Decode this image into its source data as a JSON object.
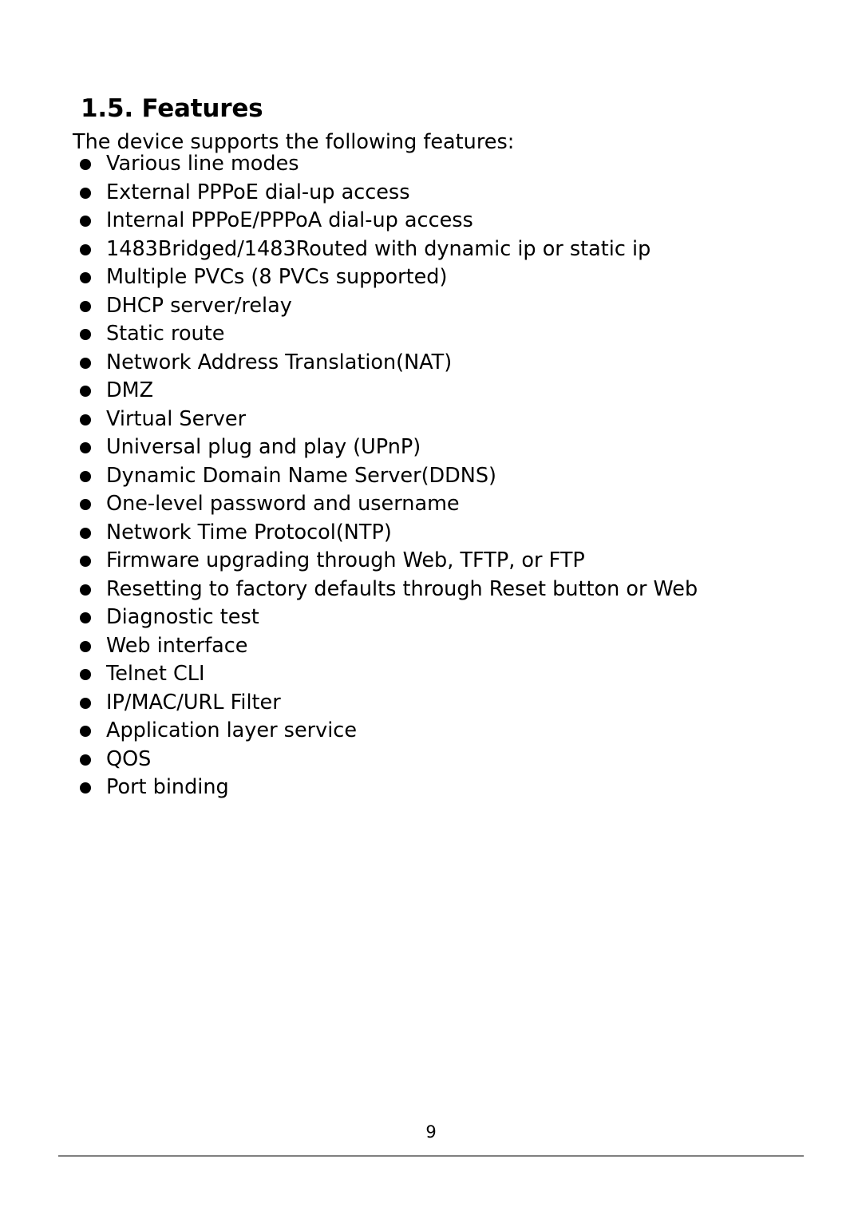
{
  "document": {
    "heading": "1.5. Features",
    "intro": "The device supports the following features:",
    "features": [
      "Various line modes",
      "External PPPoE dial-up access",
      "Internal PPPoE/PPPoA dial-up access",
      "1483Bridged/1483Routed with dynamic ip or static ip",
      "Multiple PVCs (8 PVCs supported)",
      "DHCP server/relay",
      "Static route",
      "Network Address Translation(NAT)",
      "DMZ",
      "Virtual Server",
      "Universal plug and play (UPnP)",
      "Dynamic Domain Name Server(DDNS)",
      "One-level password and username",
      "Network Time Protocol(NTP)",
      "Firmware upgrading through Web, TFTP, or FTP",
      "Resetting to factory defaults through Reset button or Web",
      "Diagnostic test",
      "Web interface",
      "Telnet CLI",
      "IP/MAC/URL Filter",
      "Application layer service",
      "QOS",
      "Port binding"
    ],
    "bullet_glyph": "filled-circle"
  },
  "footer": {
    "page_number": "9",
    "rule_color": "#808080"
  },
  "colors": {
    "page_background": "#ffffff",
    "text": "#000000",
    "rule": "#808080"
  }
}
